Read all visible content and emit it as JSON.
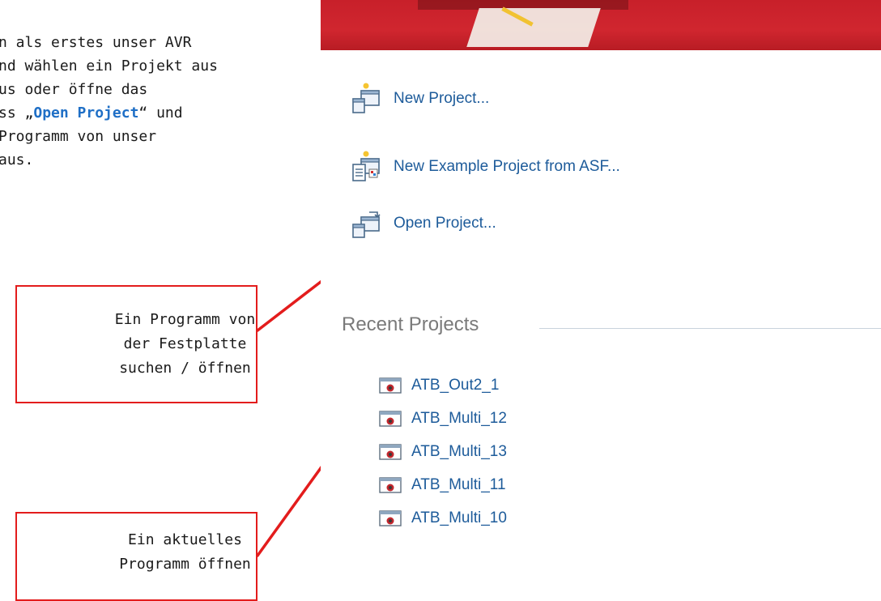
{
  "instruction": {
    "lines": [
      "n als erstes unser AVR",
      "nd wählen ein Projekt aus",
      "us oder öffne das",
      "ss „",
      "Programm von unser",
      "aus."
    ],
    "line4_highlight": "Open Project",
    "line4_suffix": "“ und"
  },
  "callouts": {
    "open_from_disk": [
      "Ein Programm von",
      "der Festplatte",
      "suchen / öffnen"
    ],
    "open_recent": [
      "Ein aktuelles",
      "Programm öffnen"
    ]
  },
  "start_page": {
    "actions": {
      "new_project": "New Project...",
      "new_example_project": "New Example Project from ASF...",
      "open_project": "Open Project..."
    },
    "recent_heading": "Recent Projects",
    "recent_projects": [
      "ATB_Out2_1",
      "ATB_Multi_12",
      "ATB_Multi_13",
      "ATB_Multi_11",
      "ATB_Multi_10"
    ]
  },
  "colors": {
    "callout_border": "#e31c1c",
    "arrow": "#e31c1c",
    "link": "#1d5b9a",
    "highlight": "#1f6fc6",
    "banner": "#c8202a"
  },
  "icons": {
    "new_project": "new-project-icon",
    "new_example_project": "new-example-project-icon",
    "open_project": "open-project-icon",
    "recent_project": "project-file-icon"
  }
}
